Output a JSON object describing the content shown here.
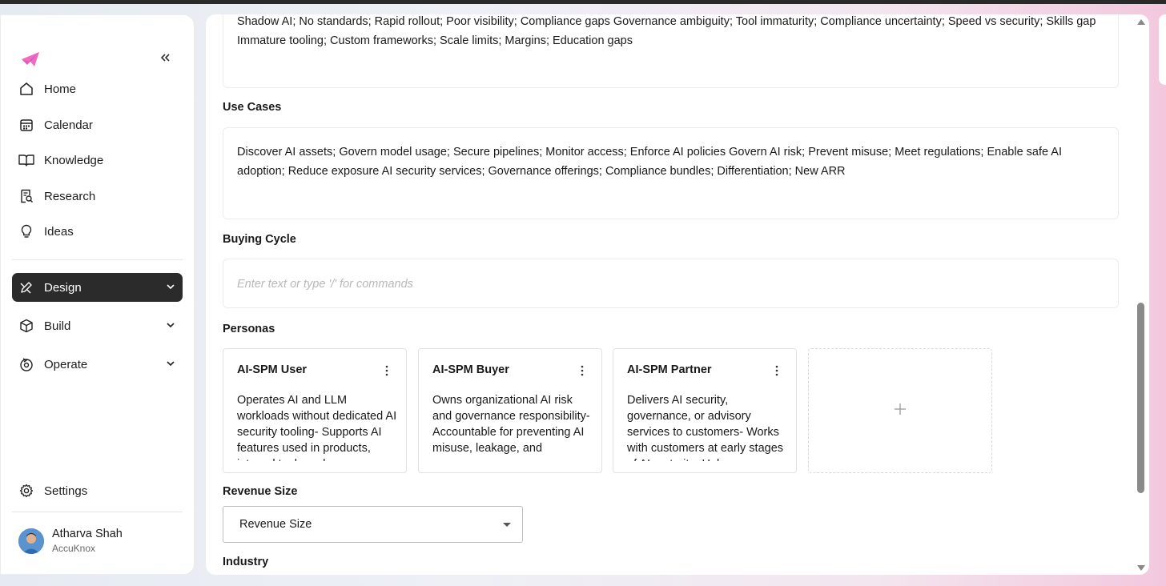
{
  "sidebar": {
    "items": [
      {
        "label": "Home"
      },
      {
        "label": "Calendar"
      },
      {
        "label": "Knowledge"
      },
      {
        "label": "Research"
      },
      {
        "label": "Ideas"
      },
      {
        "label": "Design"
      },
      {
        "label": "Build"
      },
      {
        "label": "Operate"
      },
      {
        "label": "Settings"
      }
    ],
    "user": {
      "name": "Atharva Shah",
      "org": "AccuKnox"
    }
  },
  "main": {
    "challenges_text": "Shadow AI; No standards; Rapid rollout; Poor visibility; Compliance gaps Governance ambiguity; Tool immaturity; Compliance uncertainty; Speed vs security; Skills gap Immature tooling; Custom frameworks; Scale limits; Margins; Education gaps",
    "use_cases_label": "Use Cases",
    "use_cases_text": "Discover AI assets; Govern model usage; Secure pipelines; Monitor access; Enforce AI policies Govern AI risk; Prevent misuse; Meet regulations; Enable safe AI adoption; Reduce exposure AI security services; Governance offerings; Compliance bundles; Differentiation; New ARR",
    "buying_cycle_label": "Buying Cycle",
    "buying_cycle_placeholder": "Enter text or type '/' for commands",
    "personas_label": "Personas",
    "personas": [
      {
        "title": "AI-SPM User",
        "body": "Operates AI and LLM workloads without dedicated AI security tooling- Supports AI features used in products, internal tools and"
      },
      {
        "title": "AI-SPM Buyer",
        "body": "Owns organizational AI risk and governance responsibility- Accountable for preventing AI misuse, leakage, and"
      },
      {
        "title": "AI-SPM Partner",
        "body": "Delivers AI security, governance, or advisory services to customers- Works with customers at early stages of AI maturity- Helps"
      }
    ],
    "revenue_size_label": "Revenue Size",
    "revenue_size_value": "Revenue Size",
    "industry_label": "Industry"
  },
  "colors": {
    "active_nav_bg": "#2b2b2b",
    "logo": "#e040a0"
  }
}
